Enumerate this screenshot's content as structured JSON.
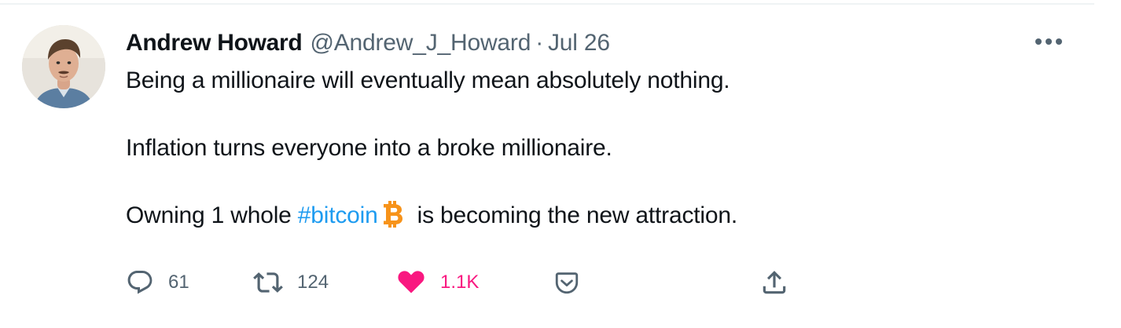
{
  "tweet": {
    "author": {
      "display_name": "Andrew Howard",
      "handle": "@Andrew_J_Howard",
      "avatar_icon": "user-avatar"
    },
    "separator": "·",
    "date": "Jul 26",
    "text": {
      "line1": "Being a millionaire will eventually mean absolutely nothing.",
      "line2": "Inflation turns everyone into a broke millionaire.",
      "line3_before": "Owning 1 whole ",
      "hashtag": "#bitcoin",
      "emoji_icon": "bitcoin-icon",
      "line3_after": "is becoming the new attraction."
    },
    "actions": {
      "reply_count": "61",
      "retweet_count": "124",
      "like_count": "1.1K",
      "reply_icon": "reply-icon",
      "retweet_icon": "retweet-icon",
      "like_icon": "heart-icon",
      "tip_icon": "tip-icon",
      "share_icon": "share-icon"
    },
    "more_icon": "more-icon"
  },
  "colors": {
    "text_primary": "#0f1419",
    "text_secondary": "#536471",
    "link": "#1d9bf0",
    "like": "#f91880",
    "bitcoin": "#f7931a",
    "divider": "#eff3f4"
  }
}
